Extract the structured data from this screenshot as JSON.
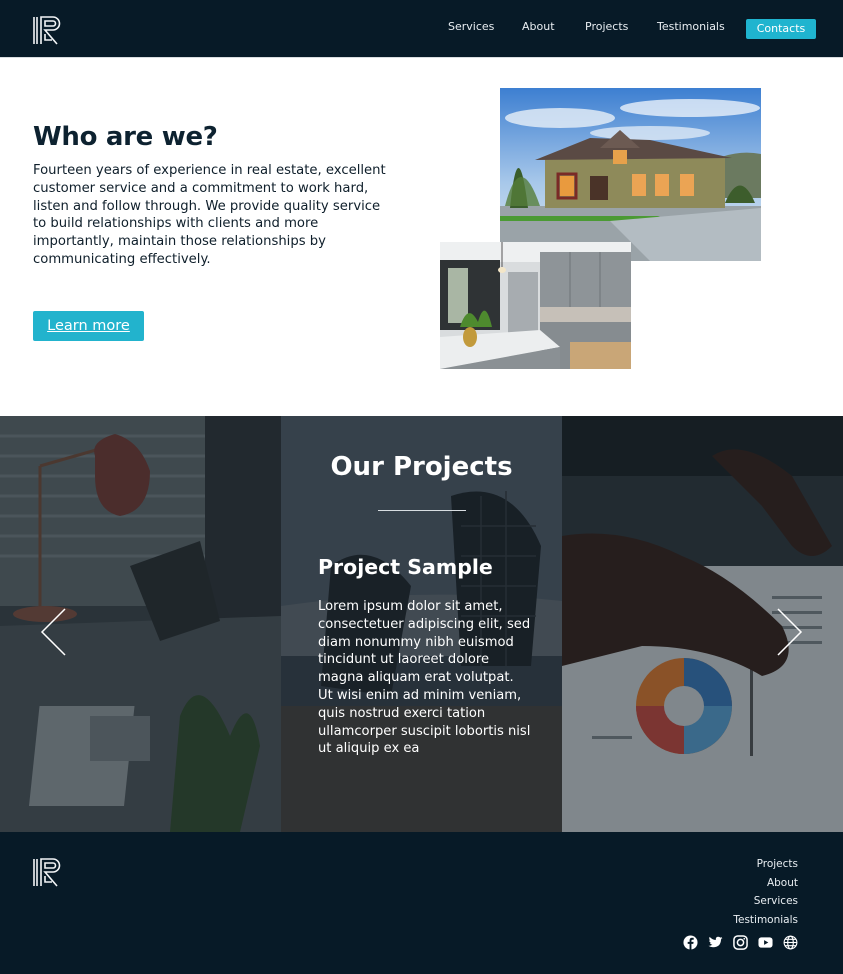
{
  "header": {
    "nav": [
      "Services",
      "About",
      "Projects",
      "Testimonials"
    ],
    "contact_label": "Contacts"
  },
  "about": {
    "title": "Who are we?",
    "text": "Fourteen years of experience in real estate, excellent customer service and a commitment to work hard, listen and follow through. We provide quality service to build relationships with clients and more importantly, maintain those relationships by communicating effectively.",
    "button_label": "Learn more"
  },
  "projects": {
    "title": "Our Projects",
    "sample_title": "Project Sample",
    "sample_text": "Lorem ipsum dolor sit amet, consectetuer adipiscing elit, sed diam nonummy nibh euismod tincidunt ut laoreet dolore magna aliquam erat volutpat. Ut wisi enim ad minim veniam, quis nostrud exerci tation ullamcorper suscipit lobortis nisl ut aliquip ex ea"
  },
  "footer": {
    "links": [
      "Projects",
      "About",
      "Services",
      "Testimonials"
    ],
    "social_icons": [
      "facebook-icon",
      "twitter-icon",
      "instagram-icon",
      "youtube-icon",
      "globe-icon"
    ]
  },
  "colors": {
    "navy": "#071a27",
    "accent": "#22b3cd"
  }
}
